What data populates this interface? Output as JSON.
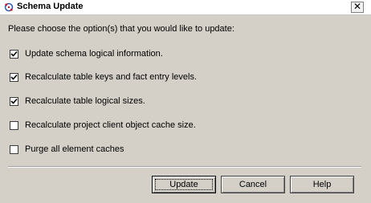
{
  "window": {
    "title": "Schema Update",
    "close_glyph": "✕"
  },
  "prompt": "Please choose the option(s) that you would like to update:",
  "options": [
    {
      "label": "Update schema logical information.",
      "checked": true
    },
    {
      "label": "Recalculate table keys and fact entry levels.",
      "checked": true
    },
    {
      "label": "Recalculate table logical sizes.",
      "checked": true
    },
    {
      "label": "Recalculate project client object cache size.",
      "checked": false
    },
    {
      "label": "Purge all element caches",
      "checked": false
    }
  ],
  "buttons": {
    "update": "Update",
    "cancel": "Cancel",
    "help": "Help"
  },
  "icons": {
    "app": "schema-update-app-icon",
    "close": "close-icon",
    "check": "checkmark-icon"
  },
  "colors": {
    "dialog_bg": "#d4d0c8",
    "icon_red": "#c8102e",
    "icon_blue": "#2a5db0"
  }
}
